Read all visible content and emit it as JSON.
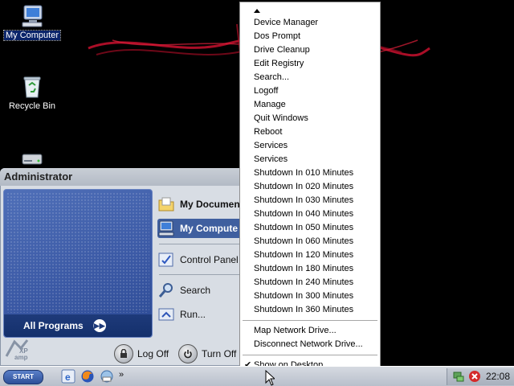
{
  "desktop": {
    "icons": [
      {
        "label": "My Computer",
        "icon": "my-computer-icon"
      },
      {
        "label": "Recycle Bin",
        "icon": "recycle-bin-icon"
      },
      {
        "label": "",
        "icon": "drive-icon"
      }
    ]
  },
  "start_menu": {
    "user": "Administrator",
    "all_programs": "All Programs",
    "items": [
      {
        "label": "My Documen",
        "icon": "my-documents-icon"
      },
      {
        "label": "My Compute",
        "icon": "my-computer-icon"
      },
      {
        "label": "Control Panel",
        "icon": "control-panel-icon"
      },
      {
        "label": "Search",
        "icon": "search-icon"
      },
      {
        "label": "Run...",
        "icon": "run-icon"
      }
    ],
    "logo_text": "XP amp",
    "log_off": "Log Off",
    "turn_off": "Turn Off"
  },
  "context_menu": {
    "items": [
      "Device Manager",
      "Dos Prompt",
      "Drive Cleanup",
      "Edit Registry",
      "Search...",
      "Logoff",
      "Manage",
      "Quit Windows",
      "Reboot",
      "Services",
      "Services",
      "Shutdown In 010 Minutes",
      "Shutdown In 020 Minutes",
      "Shutdown In 030 Minutes",
      "Shutdown In 040 Minutes",
      "Shutdown In 050 Minutes",
      "Shutdown In 060 Minutes",
      "Shutdown In 120 Minutes",
      "Shutdown In 180 Minutes",
      "Shutdown In 240 Minutes",
      "Shutdown In 300 Minutes",
      "Shutdown In 360 Minutes"
    ],
    "drive_items": [
      "Map Network Drive...",
      "Disconnect Network Drive..."
    ],
    "show_on_desktop": "Show on Desktop",
    "show_on_desktop_checked": true
  },
  "taskbar": {
    "start_label": "START",
    "quick_launch": [
      "ie-icon",
      "firefox-icon",
      "email-icon"
    ],
    "overflow": "»",
    "clock": "22:08"
  },
  "colors": {
    "highlight": "#3f5f9f",
    "start_menu_bg": "#d8dde4",
    "all_programs_bg": "#1e3a7a",
    "wallpaper_red": "#c8102e"
  }
}
